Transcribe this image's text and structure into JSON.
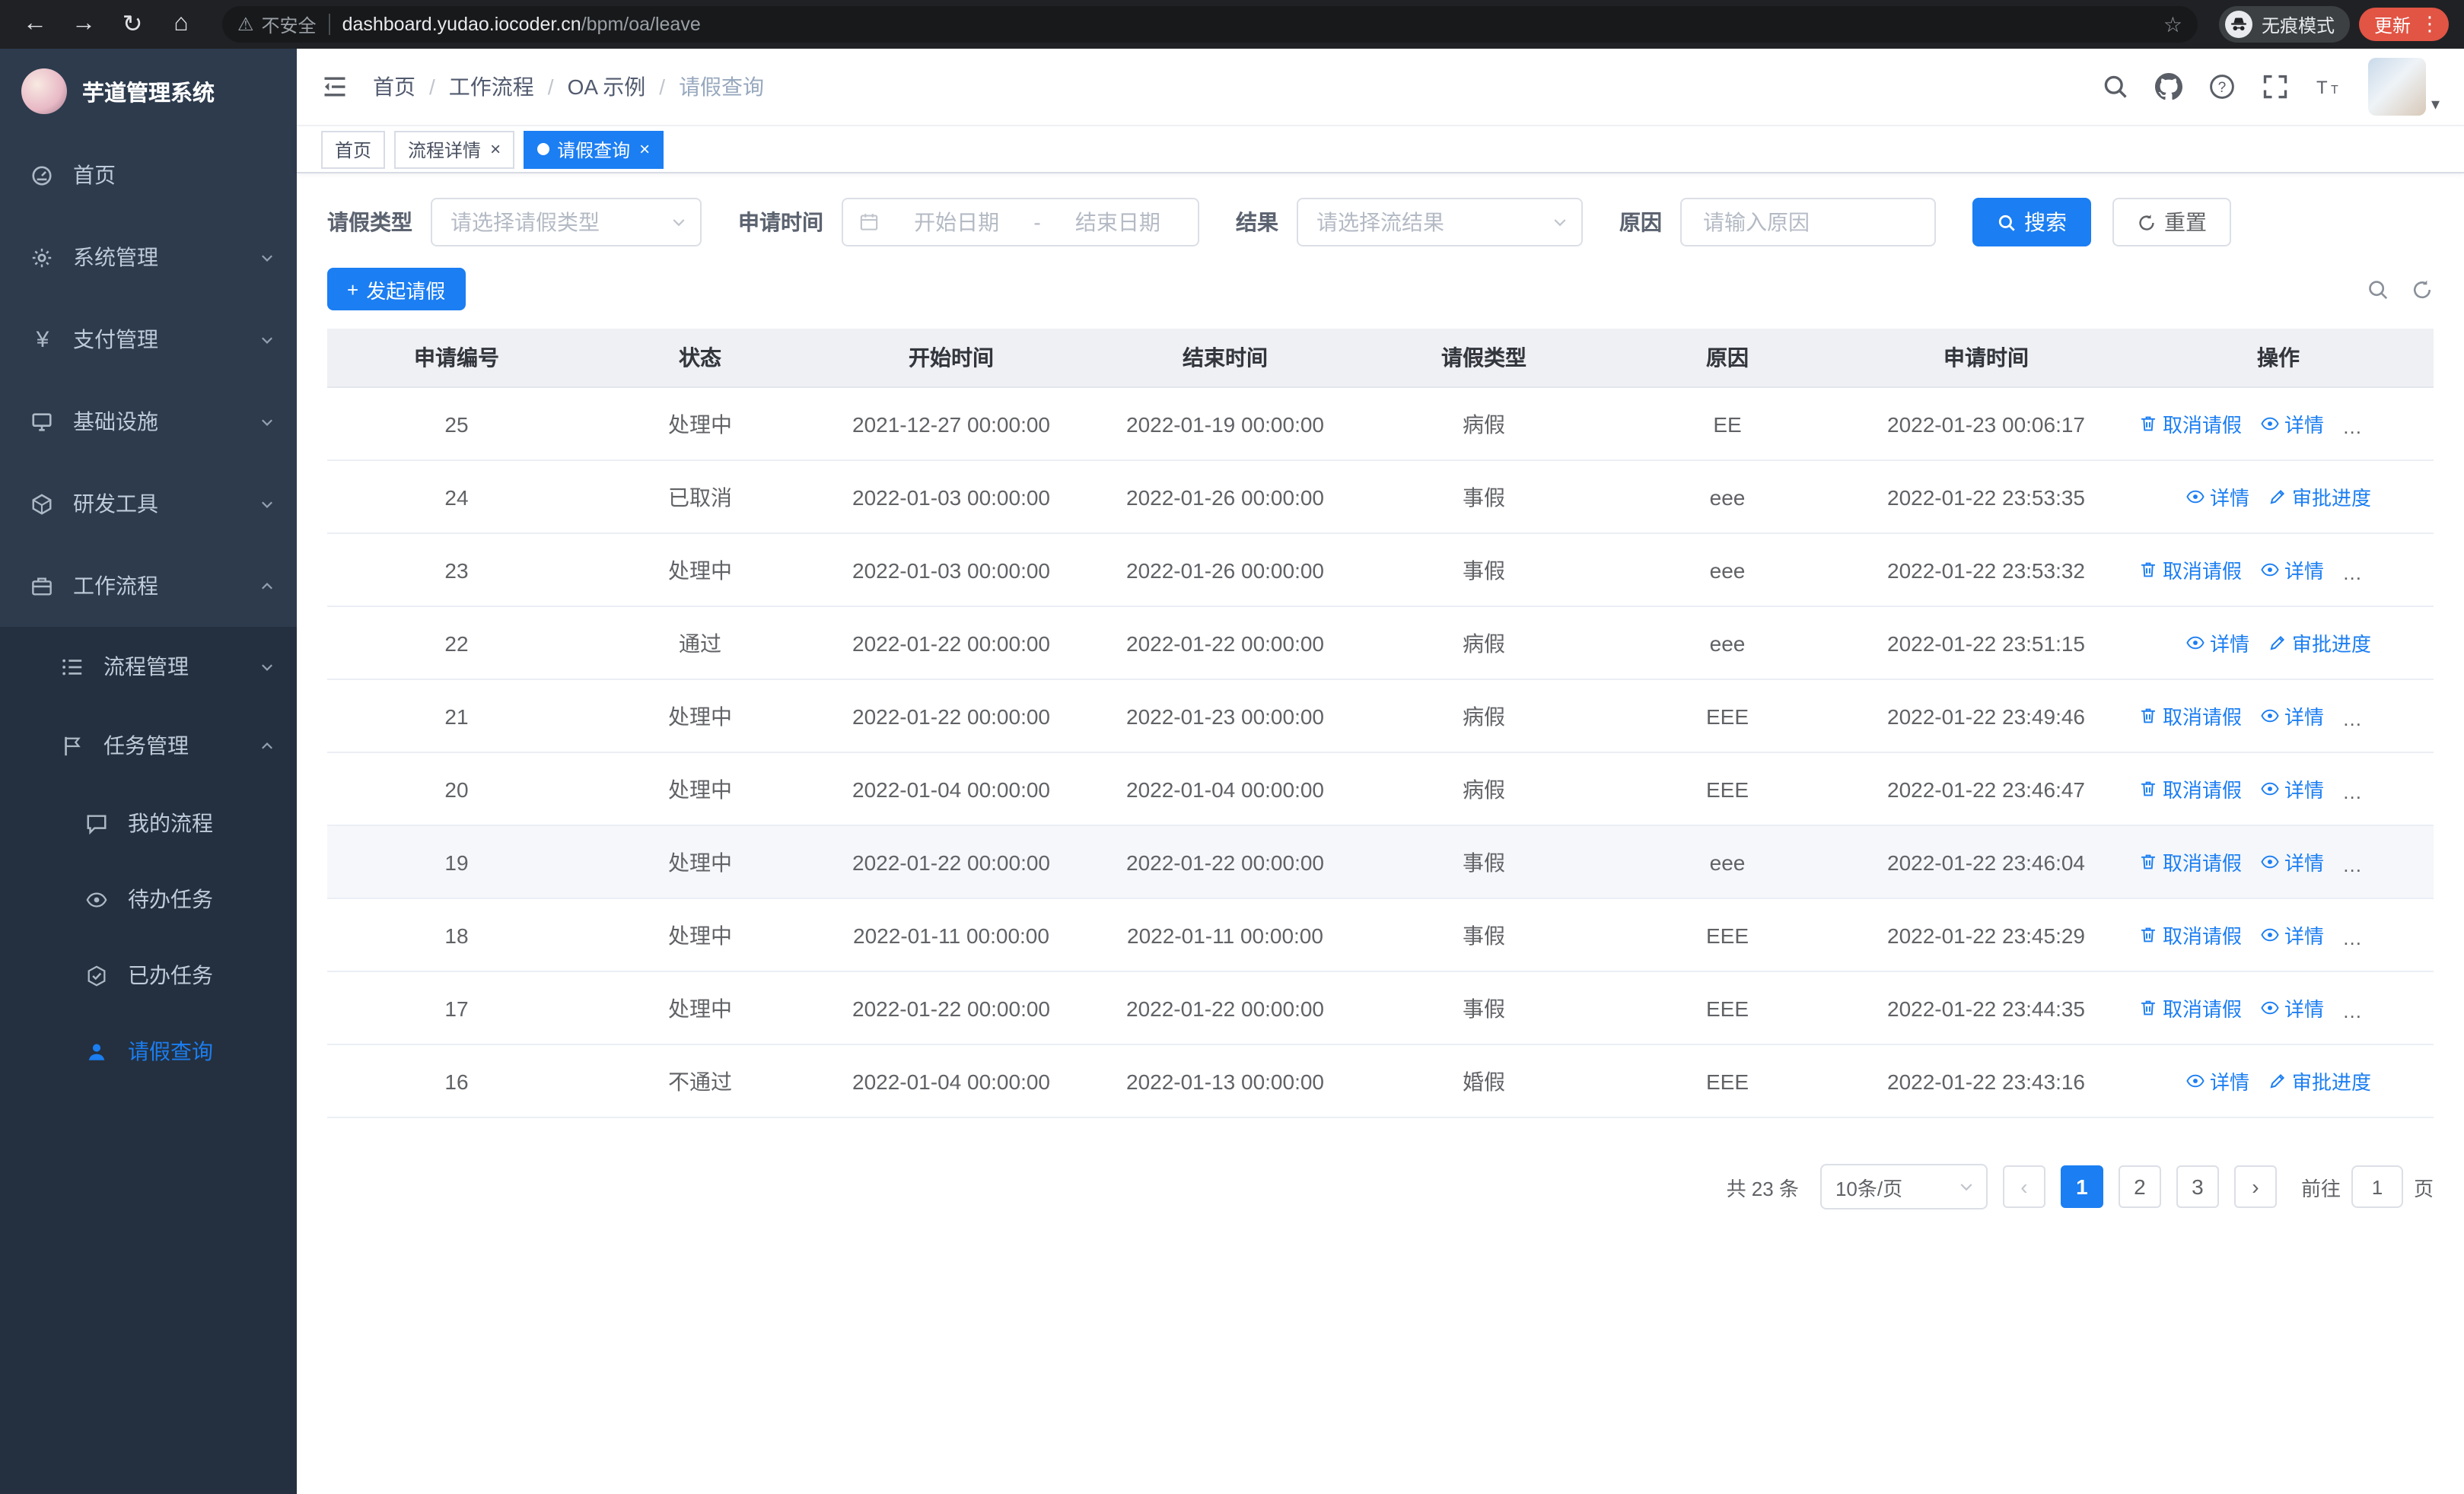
{
  "colors": {
    "primary": "#1b7ef2",
    "sidebar-bg": "#24303f",
    "sidebar-item-bg": "#2d3b4d",
    "sidebar-text": "#bfcbd9",
    "update-badge": "#e25444"
  },
  "icons": {
    "back_arrow": "←",
    "forward_arrow": "→",
    "reload": "↻",
    "home": "⌂",
    "warning": "⚠",
    "star": "☆",
    "close": "×",
    "prev": "‹",
    "next": "›",
    "plus": "+",
    "caret": "▾",
    "menu_dots": "⋮",
    "yen": "¥"
  },
  "browser": {
    "security_label": "不安全",
    "url_host": "dashboard.yudao.iocoder.cn",
    "url_path": "/bpm/oa/leave",
    "incognito_label": "无痕模式",
    "update_label": "更新"
  },
  "sidebar": {
    "app_title": "芋道管理系统",
    "items": [
      {
        "label": "首页"
      },
      {
        "label": "系统管理"
      },
      {
        "label": "支付管理"
      },
      {
        "label": "基础设施"
      },
      {
        "label": "研发工具"
      },
      {
        "label": "工作流程"
      },
      {
        "label": "流程管理"
      },
      {
        "label": "任务管理"
      },
      {
        "label": "我的流程"
      },
      {
        "label": "待办任务"
      },
      {
        "label": "已办任务"
      },
      {
        "label": "请假查询"
      }
    ]
  },
  "header": {
    "breadcrumb": [
      "首页",
      "工作流程",
      "OA 示例",
      "请假查询"
    ]
  },
  "tabs": [
    {
      "label": "首页"
    },
    {
      "label": "流程详情"
    },
    {
      "label": "请假查询"
    }
  ],
  "filters": {
    "leave_type_label": "请假类型",
    "leave_type_placeholder": "请选择请假类型",
    "apply_time_label": "申请时间",
    "start_placeholder": "开始日期",
    "date_separator": "-",
    "end_placeholder": "结束日期",
    "result_label": "结果",
    "result_placeholder": "请选择流结果",
    "reason_label": "原因",
    "reason_placeholder": "请输入原因",
    "search_label": "搜索",
    "reset_label": "重置"
  },
  "toolbar": {
    "create_label": "发起请假"
  },
  "table": {
    "columns": [
      "申请编号",
      "状态",
      "开始时间",
      "结束时间",
      "请假类型",
      "原因",
      "申请时间",
      "操作"
    ],
    "action_labels": {
      "cancel": "取消请假",
      "detail": "详情",
      "progress": "审批进度"
    },
    "rows": [
      {
        "id": "25",
        "status": "处理中",
        "start": "2021-12-27 00:00:00",
        "end": "2022-01-19 00:00:00",
        "type": "病假",
        "reason": "EE",
        "time": "2022-01-23 00:06:17"
      },
      {
        "id": "24",
        "status": "已取消",
        "start": "2022-01-03 00:00:00",
        "end": "2022-01-26 00:00:00",
        "type": "事假",
        "reason": "eee",
        "time": "2022-01-22 23:53:35"
      },
      {
        "id": "23",
        "status": "处理中",
        "start": "2022-01-03 00:00:00",
        "end": "2022-01-26 00:00:00",
        "type": "事假",
        "reason": "eee",
        "time": "2022-01-22 23:53:32"
      },
      {
        "id": "22",
        "status": "通过",
        "start": "2022-01-22 00:00:00",
        "end": "2022-01-22 00:00:00",
        "type": "病假",
        "reason": "eee",
        "time": "2022-01-22 23:51:15"
      },
      {
        "id": "21",
        "status": "处理中",
        "start": "2022-01-22 00:00:00",
        "end": "2022-01-23 00:00:00",
        "type": "病假",
        "reason": "EEE",
        "time": "2022-01-22 23:49:46"
      },
      {
        "id": "20",
        "status": "处理中",
        "start": "2022-01-04 00:00:00",
        "end": "2022-01-04 00:00:00",
        "type": "病假",
        "reason": "EEE",
        "time": "2022-01-22 23:46:47"
      },
      {
        "id": "19",
        "status": "处理中",
        "start": "2022-01-22 00:00:00",
        "end": "2022-01-22 00:00:00",
        "type": "事假",
        "reason": "eee",
        "time": "2022-01-22 23:46:04"
      },
      {
        "id": "18",
        "status": "处理中",
        "start": "2022-01-11 00:00:00",
        "end": "2022-01-11 00:00:00",
        "type": "事假",
        "reason": "EEE",
        "time": "2022-01-22 23:45:29"
      },
      {
        "id": "17",
        "status": "处理中",
        "start": "2022-01-22 00:00:00",
        "end": "2022-01-22 00:00:00",
        "type": "事假",
        "reason": "EEE",
        "time": "2022-01-22 23:44:35"
      },
      {
        "id": "16",
        "status": "不通过",
        "start": "2022-01-04 00:00:00",
        "end": "2022-01-13 00:00:00",
        "type": "婚假",
        "reason": "EEE",
        "time": "2022-01-22 23:43:16"
      }
    ]
  },
  "pagination": {
    "total_text": "共 23 条",
    "page_size": "10条/页",
    "pages": [
      "1",
      "2",
      "3"
    ],
    "goto_label": "前往",
    "goto_value": "1",
    "unit_label": "页"
  }
}
